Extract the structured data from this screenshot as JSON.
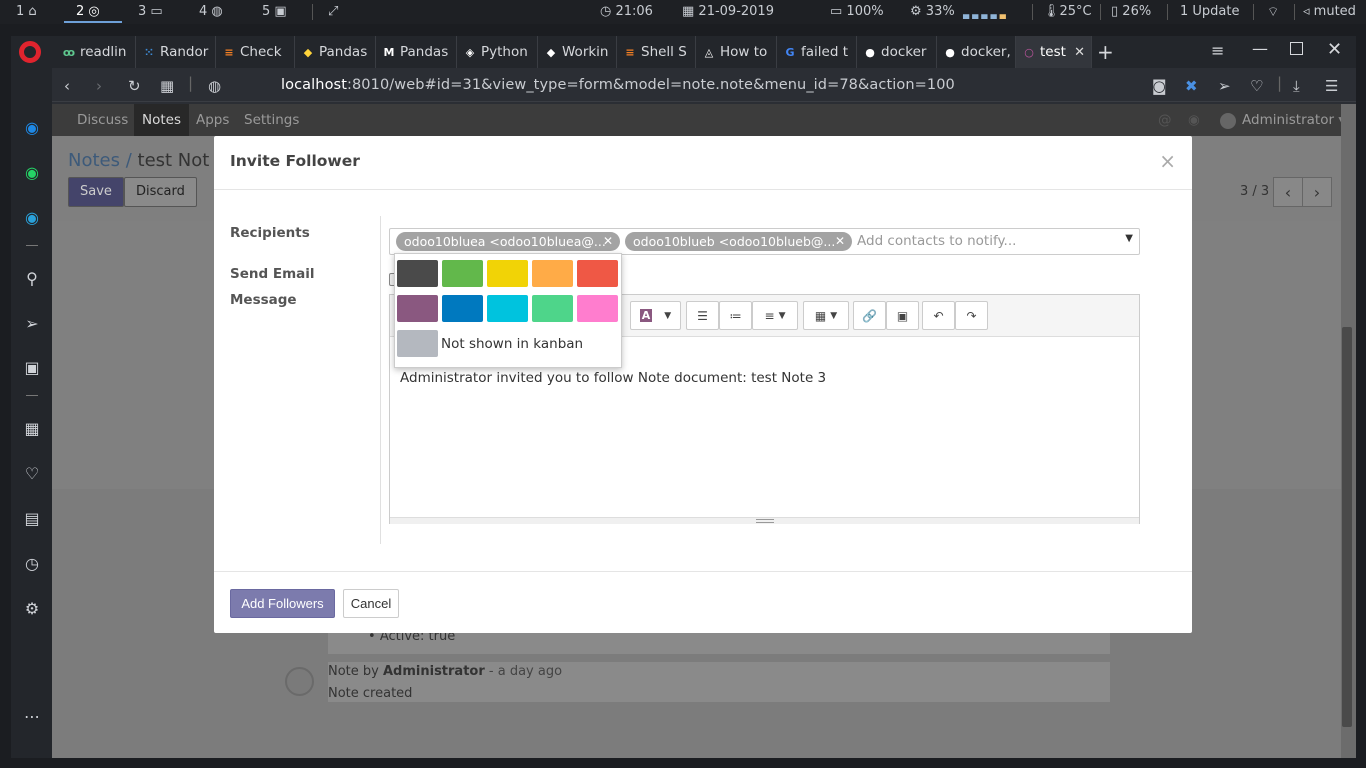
{
  "system_bar": {
    "workspaces": [
      {
        "num": "1",
        "icon": "home-icon"
      },
      {
        "num": "2",
        "icon": "chrome-icon"
      },
      {
        "num": "3",
        "icon": "folder-icon"
      },
      {
        "num": "4",
        "icon": "globe-icon"
      },
      {
        "num": "5",
        "icon": "terminal-icon"
      }
    ],
    "clock": "21:06",
    "date": "21-09-2019",
    "battery": "100%",
    "cpu": "33%",
    "temp": "25°C",
    "memory": "26%",
    "updates": "1 Update",
    "volume": "muted"
  },
  "browser": {
    "tabs": [
      {
        "label": "readlin",
        "icon": "readline-icon",
        "icon_glyph": "ꝏ",
        "icon_color": "#5fc88f"
      },
      {
        "label": "Randor",
        "icon": "dots-grid-icon",
        "icon_glyph": "⁙",
        "icon_color": "#3d8bd6"
      },
      {
        "label": "Check",
        "icon": "stackoverflow-icon",
        "icon_glyph": "≡",
        "icon_color": "#f48024"
      },
      {
        "label": "Pandas",
        "icon": "python-icon",
        "icon_glyph": "◆",
        "icon_color": "#ffd43b"
      },
      {
        "label": "Pandas",
        "icon": "medium-icon",
        "icon_glyph": "M",
        "icon_color": "#ffffff"
      },
      {
        "label": "Python",
        "icon": "python-logo-icon",
        "icon_glyph": "◈",
        "icon_color": "#ffffff"
      },
      {
        "label": "Workin",
        "icon": "python-icon",
        "icon_glyph": "◆",
        "icon_color": "#ffffff"
      },
      {
        "label": "Shell S",
        "icon": "stackoverflow-icon",
        "icon_glyph": "≡",
        "icon_color": "#f48024"
      },
      {
        "label": "How to",
        "icon": "site-icon",
        "icon_glyph": "◬",
        "icon_color": "#ffffff"
      },
      {
        "label": "failed t",
        "icon": "google-icon",
        "icon_glyph": "G",
        "icon_color": "#4285f4"
      },
      {
        "label": "docker",
        "icon": "github-icon",
        "icon_glyph": "●",
        "icon_color": "#ffffff"
      },
      {
        "label": "docker,",
        "icon": "github-icon",
        "icon_glyph": "●",
        "icon_color": "#ffffff"
      },
      {
        "label": "test",
        "icon": "odoo-icon",
        "icon_glyph": "○",
        "icon_color": "#c055a0"
      }
    ],
    "url_host": "localhost",
    "url_rest": ":8010/web#id=31&view_type=form&model=note.note&menu_id=78&action=100"
  },
  "odoo": {
    "menu": [
      "Discuss",
      "Notes",
      "Apps",
      "Settings"
    ],
    "user": "Administrator",
    "breadcrumb_parent": "Notes /",
    "breadcrumb_current": "test Not",
    "save_label": "Save",
    "discard_label": "Discard",
    "pager": "3 / 3",
    "chatter": [
      {
        "text": "Active: true"
      },
      {
        "author_prefix": "Note by ",
        "author": "Administrator",
        "time": " - a day ago",
        "body": "Note created"
      }
    ]
  },
  "dialog": {
    "title": "Invite Follower",
    "recipients_label": "Recipients",
    "send_email_label": "Send Email",
    "message_label": "Message",
    "tags": [
      "odoo10bluea <odoo10bluea@...",
      "odoo10blueb <odoo10blueb@..."
    ],
    "recipients_placeholder": "Add contacts to notify...",
    "message_body": "Administrator invited you to follow Note document: test Note 3",
    "add_label": "Add Followers",
    "cancel_label": "Cancel"
  },
  "color_picker": {
    "colors": [
      "#4a4a4a",
      "#62b84b",
      "#f1d306",
      "#ffab47",
      "#ef5845",
      "#8a5880",
      "#0079bf",
      "#00c3de",
      "#4ed58a",
      "#ff7dce"
    ],
    "no_color": "#b4b8bf",
    "no_color_label": "Not shown in kanban"
  }
}
